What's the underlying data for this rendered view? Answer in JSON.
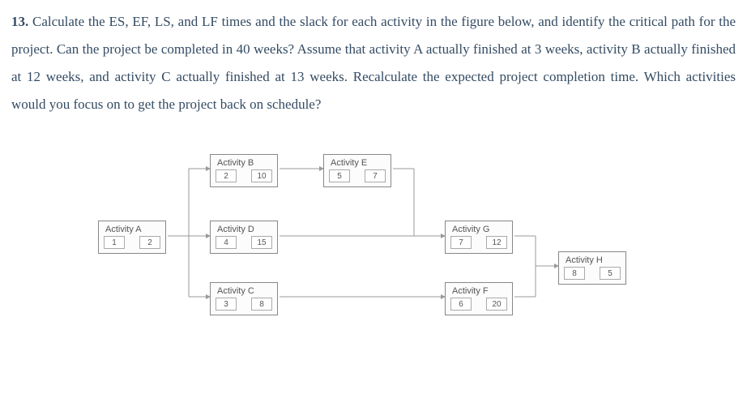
{
  "question": {
    "number": "13.",
    "text": "Calculate the ES, EF, LS, and LF times and the slack for each activity in the figure below, and identify the critical path for the project. Can the project be completed in 40 weeks? Assume that activity A actually finished at 3 weeks, activity B actually finished at 12 weeks, and activity C actually finished at 13 weeks. Recalculate the expected project completion time. Which activities would you focus on to get the project back on schedule?"
  },
  "nodes": {
    "A": {
      "label": "Activity A",
      "left": "1",
      "right": "2"
    },
    "B": {
      "label": "Activity B",
      "left": "2",
      "right": "10"
    },
    "C": {
      "label": "Activity C",
      "left": "3",
      "right": "8"
    },
    "D": {
      "label": "Activity D",
      "left": "4",
      "right": "15"
    },
    "E": {
      "label": "Activity E",
      "left": "5",
      "right": "7"
    },
    "F": {
      "label": "Activity F",
      "left": "6",
      "right": "20"
    },
    "G": {
      "label": "Activity G",
      "left": "7",
      "right": "12"
    },
    "H": {
      "label": "Activity H",
      "left": "8",
      "right": "5"
    }
  },
  "chart_data": {
    "type": "diagram",
    "title": "Project activity network",
    "activities": [
      {
        "id": "A",
        "name": "Activity A",
        "val1": 1,
        "val2": 2,
        "predecessors": []
      },
      {
        "id": "B",
        "name": "Activity B",
        "val1": 2,
        "val2": 10,
        "predecessors": [
          "A"
        ]
      },
      {
        "id": "C",
        "name": "Activity C",
        "val1": 3,
        "val2": 8,
        "predecessors": [
          "A"
        ]
      },
      {
        "id": "D",
        "name": "Activity D",
        "val1": 4,
        "val2": 15,
        "predecessors": [
          "A"
        ]
      },
      {
        "id": "E",
        "name": "Activity E",
        "val1": 5,
        "val2": 7,
        "predecessors": [
          "B"
        ]
      },
      {
        "id": "F",
        "name": "Activity F",
        "val1": 6,
        "val2": 20,
        "predecessors": [
          "C"
        ]
      },
      {
        "id": "G",
        "name": "Activity G",
        "val1": 7,
        "val2": 12,
        "predecessors": [
          "D",
          "E"
        ]
      },
      {
        "id": "H",
        "name": "Activity H",
        "val1": 8,
        "val2": 5,
        "predecessors": [
          "F",
          "G"
        ]
      }
    ],
    "edges": [
      [
        "A",
        "B"
      ],
      [
        "A",
        "D"
      ],
      [
        "A",
        "C"
      ],
      [
        "B",
        "E"
      ],
      [
        "D",
        "G"
      ],
      [
        "E",
        "G"
      ],
      [
        "C",
        "F"
      ],
      [
        "G",
        "H"
      ],
      [
        "F",
        "H"
      ]
    ]
  }
}
